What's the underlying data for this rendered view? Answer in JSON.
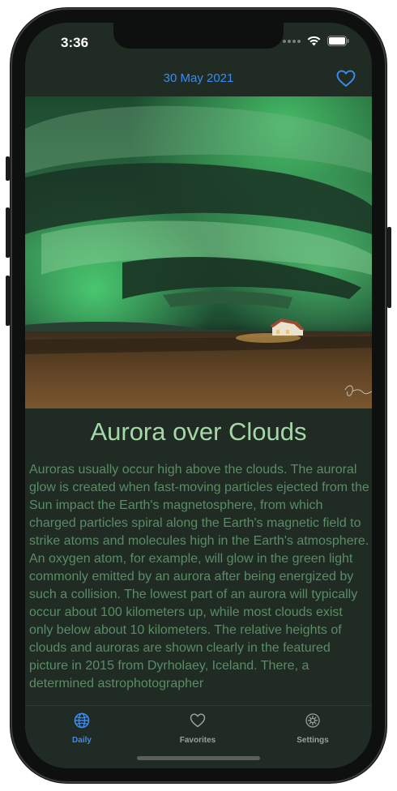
{
  "status_bar": {
    "time": "3:36"
  },
  "nav": {
    "date": "30 May 2021",
    "favorite_icon": "heart-outline-icon"
  },
  "apod": {
    "title": "Aurora over Clouds",
    "explanation": "Auroras usually occur high above the clouds.  The auroral glow is created when fast-moving particles ejected from the Sun impact the Earth's magnetosphere, from which charged particles spiral along the Earth's magnetic field to strike atoms and molecules high in the Earth's atmosphere.  An oxygen atom, for example, will glow in the green light commonly emitted by an aurora after being energized by such a collision.  The lowest part of an aurora will typically occur about 100 kilometers up, while most clouds exist only below about 10 kilometers.  The relative heights of clouds and auroras are shown clearly in the featured picture in 2015 from Dyrholaey, Iceland. There, a determined astrophotographer"
  },
  "tabs": [
    {
      "label": "Daily",
      "icon": "globe-icon",
      "selected": true
    },
    {
      "label": "Favorites",
      "icon": "heart-icon",
      "selected": false
    },
    {
      "label": "Settings",
      "icon": "gear-icon",
      "selected": false
    }
  ],
  "colors": {
    "accent": "#3c8cf0",
    "background": "#1f2b23",
    "title": "#a6d7a9",
    "body_text": "#5a8c66",
    "tab_inactive": "#9aa09c"
  }
}
